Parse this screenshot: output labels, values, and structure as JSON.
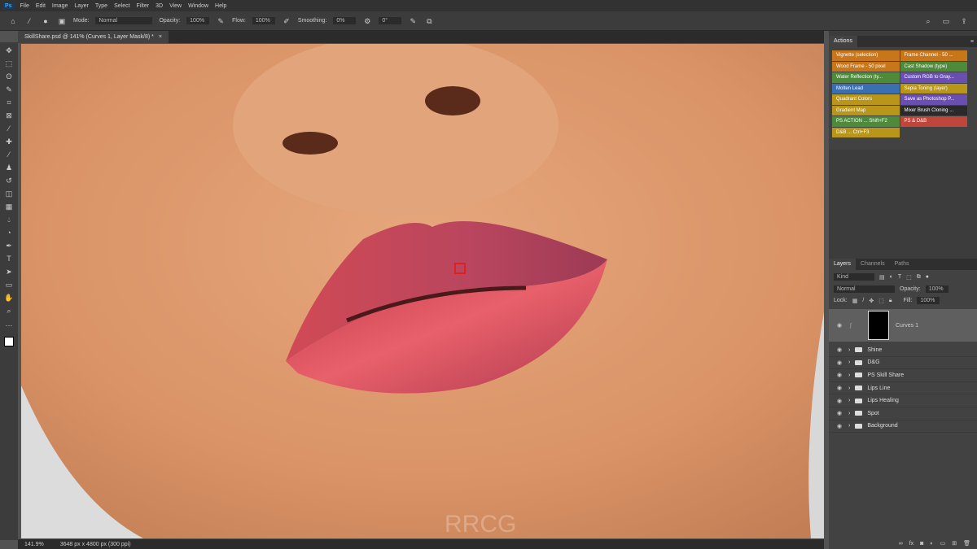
{
  "menu": [
    "File",
    "Edit",
    "Image",
    "Layer",
    "Type",
    "Select",
    "Filter",
    "3D",
    "View",
    "Window",
    "Help"
  ],
  "options": {
    "mode_label": "Mode:",
    "mode": "Normal",
    "opacity_label": "Opacity:",
    "opacity": "100%",
    "flow_label": "Flow:",
    "flow": "100%",
    "smoothing_label": "Smoothing:",
    "smoothing": "0%",
    "angle": "0°"
  },
  "doc_tab": "SkillShare.psd @ 141% (Curves 1, Layer Mask/8) *",
  "status": {
    "zoom": "141.9%",
    "size": "3648 px x 4800 px (300 ppi)"
  },
  "watermark": "RRCG",
  "actions": {
    "title": "Actions",
    "left": [
      {
        "label": "Vignette (selection)",
        "color": "#c8761a"
      },
      {
        "label": "Wood Frame - 50 pixel",
        "color": "#c8761a"
      },
      {
        "label": "Water Reflection (ty...",
        "color": "#4d8a3a"
      },
      {
        "label": "Molten Lead",
        "color": "#3a6fb0"
      },
      {
        "label": "Quadrant Colors",
        "color": "#b8961a"
      },
      {
        "label": "Gradient Map",
        "color": "#b8961a"
      },
      {
        "label": "PS ACTION ...   Shift+F2",
        "color": "#4d8a3a"
      },
      {
        "label": "D&B ...         Ctrl+F3",
        "color": "#b8961a"
      }
    ],
    "right": [
      {
        "label": "Frame Channel - 50 ...",
        "color": "#c8761a"
      },
      {
        "label": "Cast Shadow (type)",
        "color": "#4d8a3a"
      },
      {
        "label": "Custom RGB to Gray...",
        "color": "#6a4fb0"
      },
      {
        "label": "Sepia Toning (layer)",
        "color": "#b8961a"
      },
      {
        "label": "Save as Photoshop P...",
        "color": "#6a4fb0"
      },
      {
        "label": "Mixer Brush Cloning ...",
        "color": "#2a2a2a"
      },
      {
        "label": "PS & D&B",
        "color": "#c0453a"
      }
    ]
  },
  "layers": {
    "tabs": [
      "Layers",
      "Channels",
      "Paths"
    ],
    "filter": "Kind",
    "blend": "Normal",
    "opacity_label": "Opacity:",
    "opacity": "100%",
    "lock_label": "Lock:",
    "fill_label": "Fill:",
    "fill": "100%",
    "adjustment": "Curves 1",
    "groups": [
      "Shine",
      "D&G",
      "PS Skill Share",
      "Lips Line",
      "Lips Healing",
      "Spot",
      "Background"
    ]
  }
}
